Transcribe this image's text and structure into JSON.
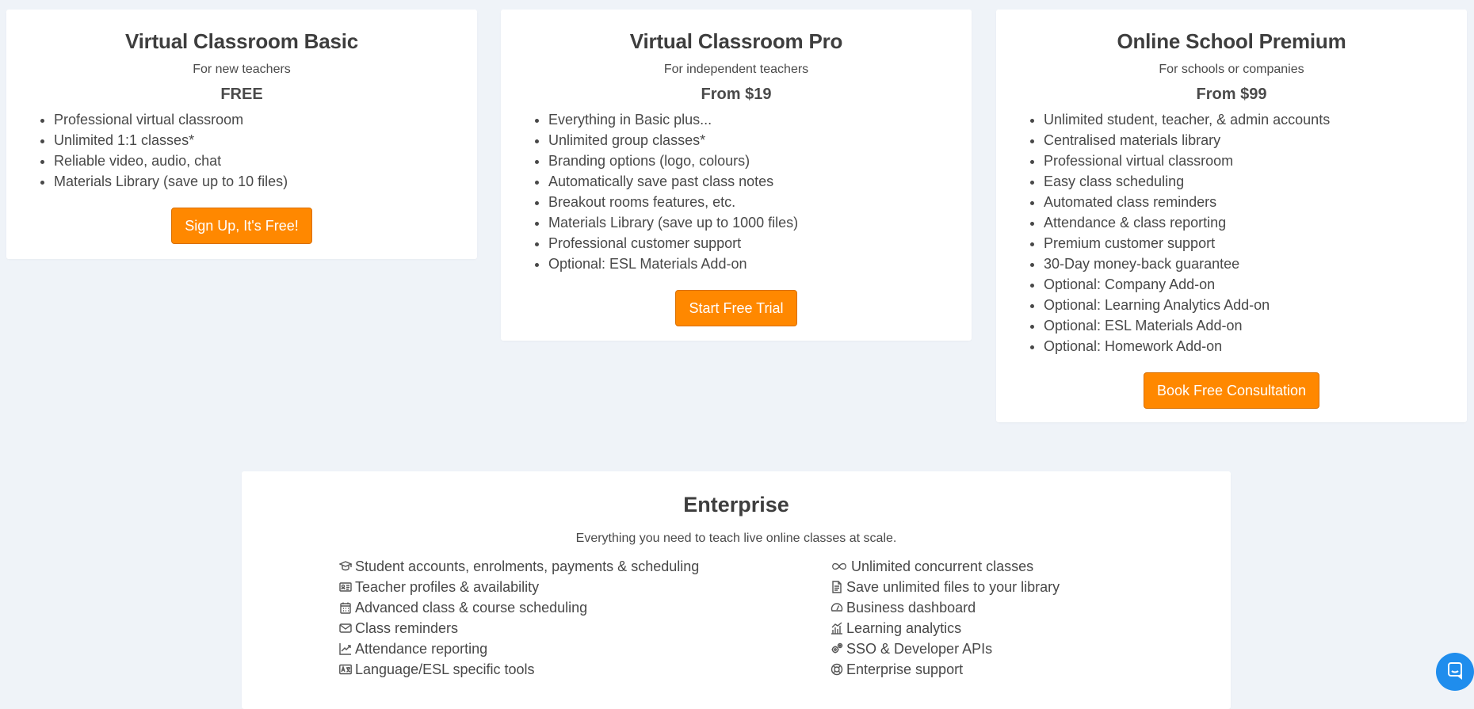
{
  "plans": [
    {
      "title": "Virtual Classroom Basic",
      "subtitle": "For new teachers",
      "price": "FREE",
      "features": [
        "Professional virtual classroom",
        "Unlimited 1:1 classes*",
        "Reliable video, audio, chat",
        "Materials Library (save up to 10 files)"
      ],
      "cta": "Sign Up, It's Free!"
    },
    {
      "title": "Virtual Classroom Pro",
      "subtitle": "For independent teachers",
      "price": "From $19",
      "features": [
        "Everything in Basic plus...",
        "Unlimited group classes*",
        "Branding options (logo, colours)",
        "Automatically save past class notes",
        "Breakout rooms features, etc.",
        "Materials Library (save up to 1000 files)",
        "Professional customer support",
        "Optional: ESL Materials Add-on"
      ],
      "cta": "Start Free Trial"
    },
    {
      "title": "Online School Premium",
      "subtitle": "For schools or companies",
      "price": "From $99",
      "features": [
        "Unlimited student, teacher, & admin accounts",
        "Centralised materials library",
        "Professional virtual classroom",
        "Easy class scheduling",
        "Automated class reminders",
        "Attendance & class reporting",
        "Premium customer support",
        "30-Day money-back guarantee",
        "Optional: Company Add-on",
        "Optional: Learning Analytics Add-on",
        "Optional: ESL Materials Add-on",
        "Optional: Homework Add-on"
      ],
      "cta": "Book Free Consultation"
    }
  ],
  "enterprise": {
    "title": "Enterprise",
    "subtitle": "Everything you need to teach live online classes at scale.",
    "left_items": [
      {
        "icon": "graduation-icon",
        "label": "Student accounts, enrolments, payments & scheduling"
      },
      {
        "icon": "id-card-icon",
        "label": "Teacher profiles & availability"
      },
      {
        "icon": "calendar-icon",
        "label": "Advanced class & course scheduling"
      },
      {
        "icon": "envelope-icon",
        "label": "Class reminders"
      },
      {
        "icon": "trend-chart-icon",
        "label": "Attendance reporting"
      },
      {
        "icon": "translate-icon",
        "label": "Language/ESL specific tools"
      }
    ],
    "right_items": [
      {
        "icon": "infinity-icon",
        "label": "Unlimited concurrent classes"
      },
      {
        "icon": "document-icon",
        "label": "Save unlimited files to your library"
      },
      {
        "icon": "speedometer-icon",
        "label": "Business dashboard"
      },
      {
        "icon": "bar-chart-icon",
        "label": "Learning analytics"
      },
      {
        "icon": "gears-icon",
        "label": "SSO & Developer APIs"
      },
      {
        "icon": "lifebuoy-icon",
        "label": "Enterprise support"
      }
    ]
  },
  "chat_widget": {
    "icon": "chat-icon"
  },
  "colors": {
    "accent": "#ff8800",
    "background": "#eff3f8",
    "chat": "#1f8ded"
  }
}
